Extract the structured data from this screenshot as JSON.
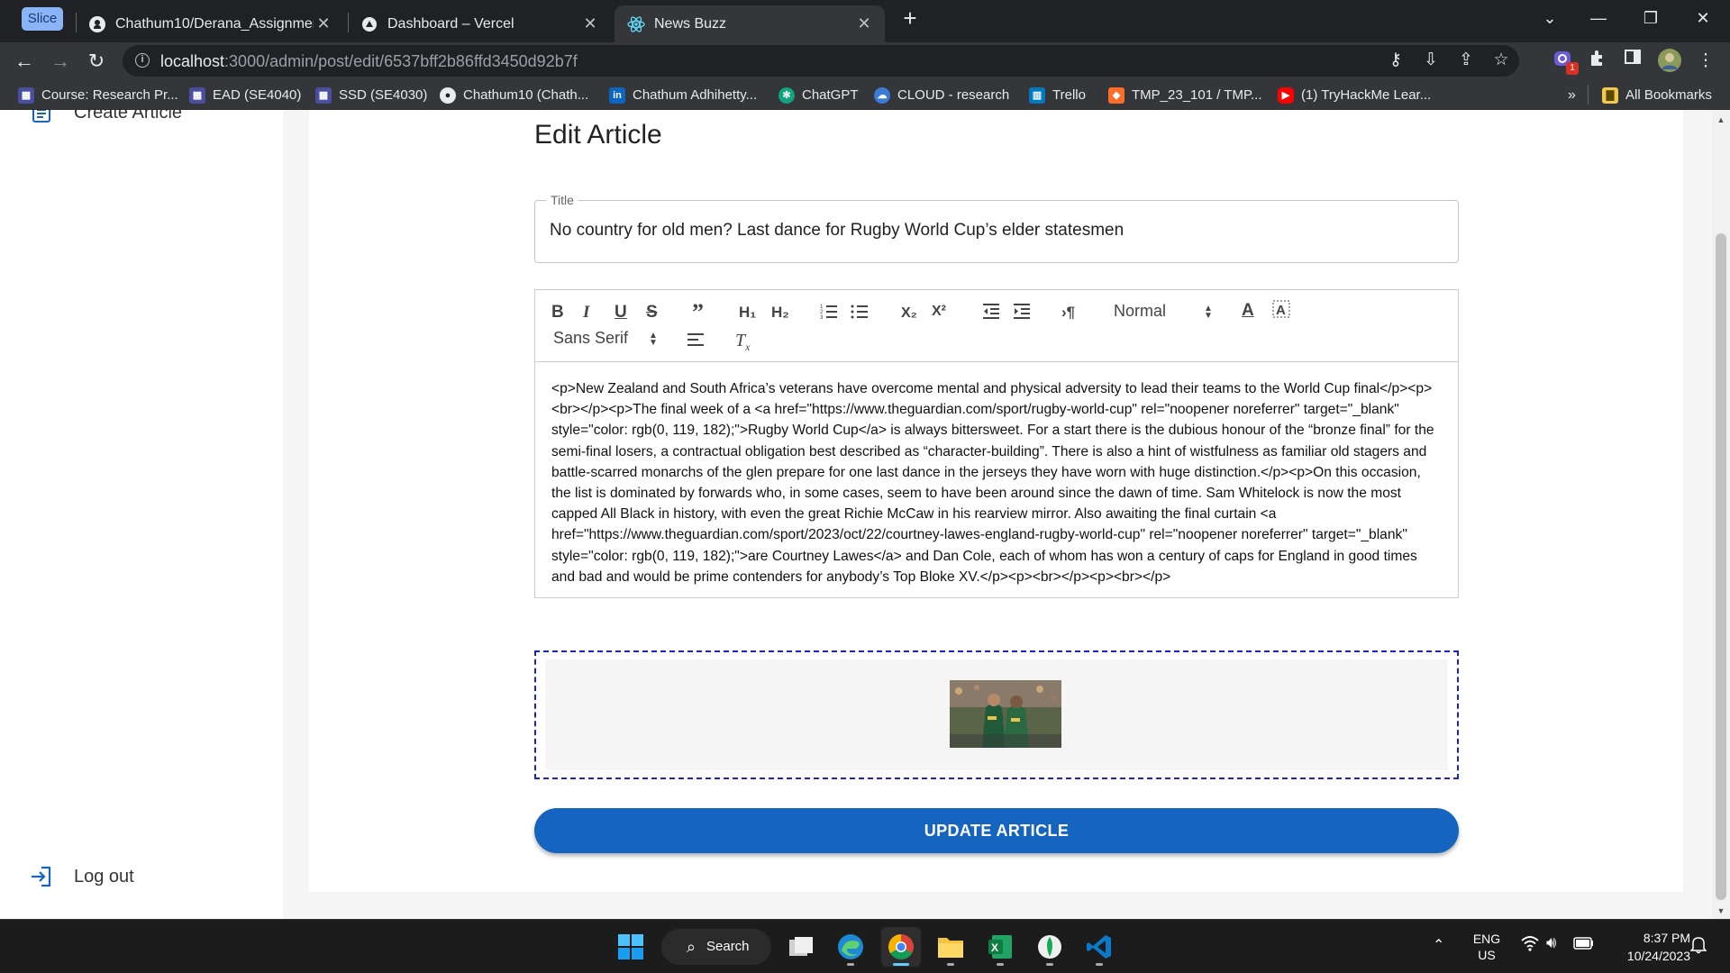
{
  "browser": {
    "slice_label": "Slice",
    "tabs": [
      {
        "title": "Chathum10/Derana_Assignment",
        "active": false
      },
      {
        "title": "Dashboard – Vercel",
        "active": false
      },
      {
        "title": "News Buzz",
        "active": true
      }
    ],
    "url_host": "localhost",
    "url_path": ":3000/admin/post/edit/6537bff2b86ffd3450d92b7f",
    "bookmarks": [
      "Course: Research Pr...",
      "EAD (SE4040)",
      "SSD (SE4030)",
      "Chathum10 (Chath...",
      "Chathum Adhihetty...",
      "ChatGPT",
      "CLOUD - research",
      "Trello",
      "TMP_23_101 / TMP...",
      "(1) TryHackMe Lear..."
    ],
    "bookmarks_overflow": "»",
    "all_bookmarks": "All Bookmarks",
    "extension_badge": "1"
  },
  "sidebar": {
    "create_article": "Create Article",
    "logout": "Log out"
  },
  "page": {
    "title": "Edit Article",
    "title_field_label": "Title",
    "title_field_value": "No country for old men? Last dance for Rugby World Cup’s elder statesmen",
    "editor": {
      "header_picker": "Normal",
      "font_picker": "Sans Serif",
      "content": "<p>New Zealand and South Africa’s veterans have overcome mental and physical adversity to lead their teams to the World Cup final</p><p><br></p><p>The final week of a <a href=\"https://www.theguardian.com/sport/rugby-world-cup\" rel=\"noopener noreferrer\" target=\"_blank\" style=\"color: rgb(0, 119, 182);\">Rugby World Cup</a> is always bittersweet. For a start there is the dubious honour of the “bronze final” for the semi-final losers, a contractual obligation best described as “character-building”. There is also a hint of wistfulness as familiar old stagers and battle-scarred monarchs of the glen prepare for one last dance in the jerseys they have worn with huge distinction.</p><p>On this occasion, the list is dominated by forwards who, in some cases, seem to have been around since the dawn of time. Sam Whitelock is now the most capped All Black in history, with even the great Richie McCaw in his rearview mirror. Also awaiting the final curtain <a href=\"https://www.theguardian.com/sport/2023/oct/22/courtney-lawes-england-rugby-world-cup\" rel=\"noopener noreferrer\" target=\"_blank\" style=\"color: rgb(0, 119, 182);\">are Courtney Lawes</a> and Dan Cole, each of whom has won a century of caps for England in good times and bad and would be prime contenders for anybody’s Top Bloke XV.</p><p><br></p><p><br></p>"
    },
    "update_button": "UPDATE ARTICLE"
  },
  "taskbar": {
    "search": "Search",
    "lang_top": "ENG",
    "lang_bottom": "US",
    "time": "8:37 PM",
    "date": "10/24/2023"
  },
  "colors": {
    "accent": "#1565c0",
    "dropzone_border": "#1a22c8",
    "chrome_dark": "#202124",
    "chrome_mid": "#35363a"
  }
}
